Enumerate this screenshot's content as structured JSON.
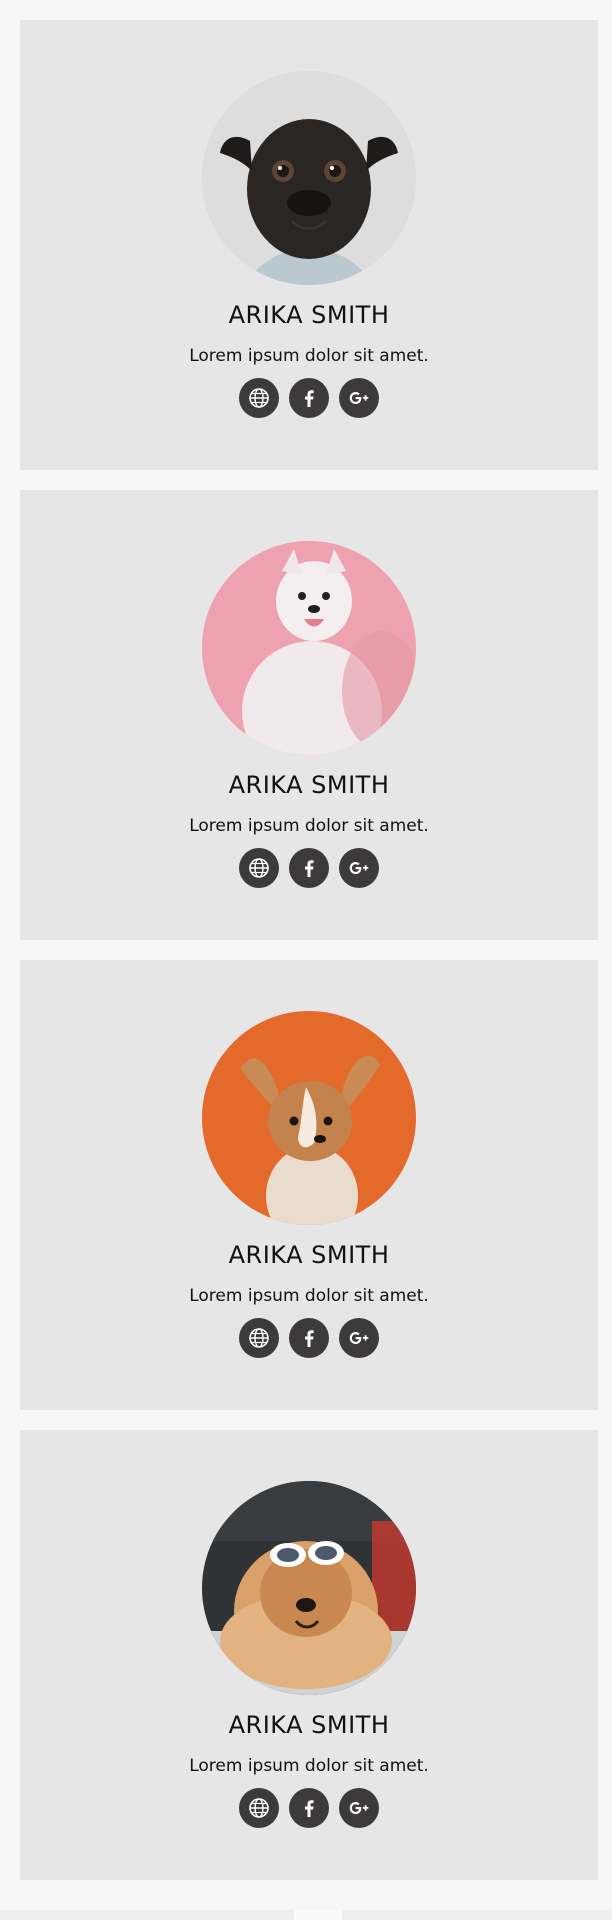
{
  "cards": [
    {
      "name": "ARIKA SMITH",
      "description": "Lorem ipsum dolor sit amet.",
      "photo": "black-pug-photo",
      "socials": [
        {
          "icon": "globe-icon"
        },
        {
          "icon": "facebook-icon"
        },
        {
          "icon": "google-plus-icon"
        }
      ]
    },
    {
      "name": "ARIKA SMITH",
      "description": "Lorem ipsum dolor sit amet.",
      "photo": "white-samoyed-photo",
      "socials": [
        {
          "icon": "globe-icon"
        },
        {
          "icon": "facebook-icon"
        },
        {
          "icon": "google-plus-icon"
        }
      ]
    },
    {
      "name": "ARIKA SMITH",
      "description": "Lorem ipsum dolor sit amet.",
      "photo": "corgi-puppy-photo",
      "socials": [
        {
          "icon": "globe-icon"
        },
        {
          "icon": "facebook-icon"
        },
        {
          "icon": "google-plus-icon"
        }
      ]
    },
    {
      "name": "ARIKA SMITH",
      "description": "Lorem ipsum dolor sit amet.",
      "photo": "chow-sunglasses-photo",
      "socials": [
        {
          "icon": "globe-icon"
        },
        {
          "icon": "facebook-icon"
        },
        {
          "icon": "google-plus-icon"
        }
      ]
    }
  ],
  "colors": {
    "page_background": "#f7f7f7",
    "card_background": "#e6e6e6",
    "social_button": "#3d3a3b",
    "text": "#111111"
  }
}
